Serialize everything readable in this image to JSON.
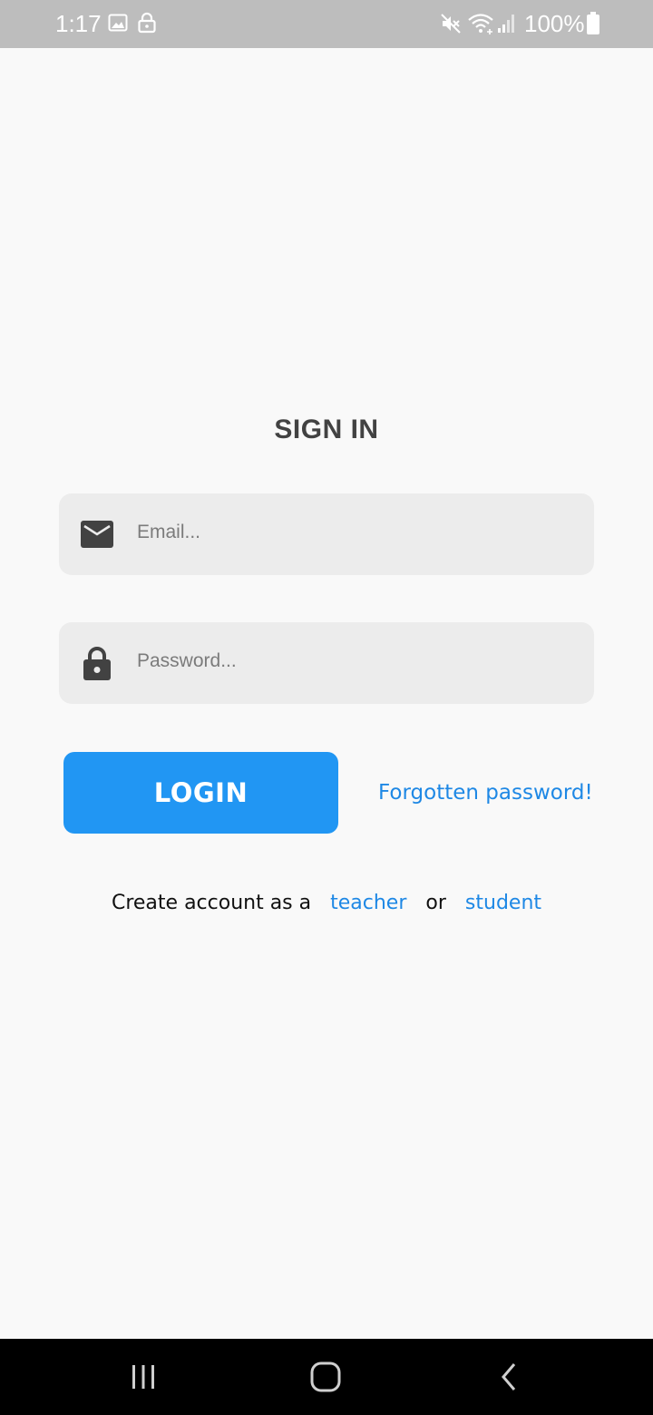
{
  "status_bar": {
    "time": "1:17",
    "battery_percent": "100%",
    "icons": [
      "image-icon",
      "lock-icon",
      "mute-icon",
      "wifi-icon",
      "signal-icon",
      "battery-icon"
    ]
  },
  "signin": {
    "title": "SIGN IN",
    "email_placeholder": "Email...",
    "email_value": "",
    "password_placeholder": "Password...",
    "password_value": "",
    "login_label": "LOGIN",
    "forgot_label": "Forgotten password!",
    "create_prefix": "Create account as a",
    "teacher_label": "teacher",
    "or_label": "or",
    "student_label": "student"
  },
  "colors": {
    "accent": "#2196f3",
    "link": "#1e88e5",
    "field_bg": "#ececec",
    "status_bar_bg": "#bdbdbd",
    "page_bg": "#f9f9f9"
  },
  "nav_bar": {
    "icons": [
      "recent-apps-icon",
      "home-icon",
      "back-icon"
    ]
  }
}
